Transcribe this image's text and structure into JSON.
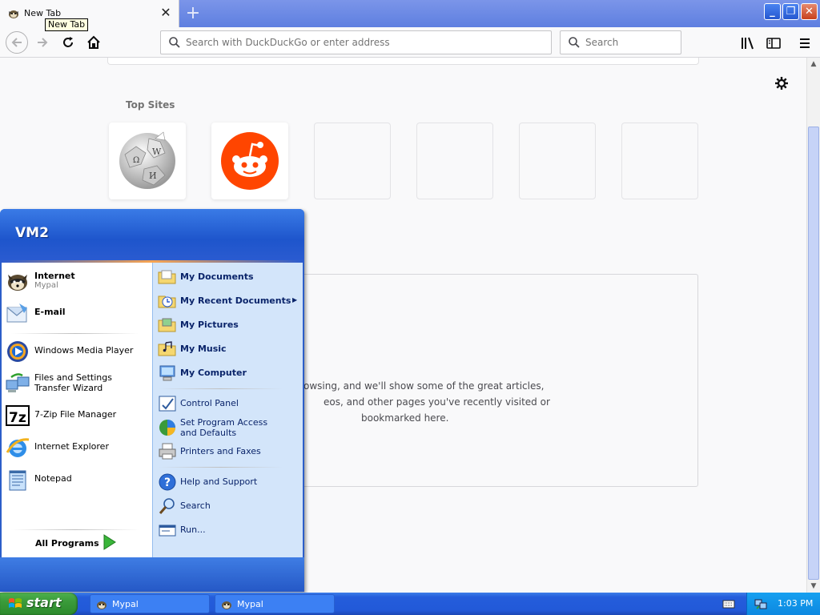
{
  "browser": {
    "tab_title": "New Tab",
    "tooltip": "New Tab",
    "url_placeholder": "Search with DuckDuckGo or enter address",
    "search_placeholder": "Search"
  },
  "newtab": {
    "topsites_title": "Top Sites",
    "topsites": [
      {
        "name": "wikipedia",
        "icon": "wikipedia-globe"
      },
      {
        "name": "reddit",
        "icon": "reddit-alien"
      },
      {
        "name": "empty"
      },
      {
        "name": "empty"
      },
      {
        "name": "empty"
      },
      {
        "name": "empty"
      }
    ],
    "highlights_text": "owsing, and we'll show some of the great articles, eos, and other pages you've recently visited or bookmarked here.",
    "highlights_lines": [
      "owsing, and we'll show some of the great articles,",
      "eos, and other pages you've recently visited or",
      "bookmarked here."
    ]
  },
  "startmenu": {
    "user": "VM2",
    "pinned": [
      {
        "label": "Internet",
        "sub": "Mypal",
        "icon": "mypal-icon"
      },
      {
        "label": "E-mail",
        "icon": "email-icon"
      }
    ],
    "recent": [
      {
        "label": "Windows Media Player",
        "icon": "media-player-icon"
      },
      {
        "label": "Files and Settings Transfer Wizard",
        "icon": "transfer-wizard-icon"
      },
      {
        "label": "7-Zip File Manager",
        "icon": "7zip-icon"
      },
      {
        "label": "Internet Explorer",
        "icon": "ie-icon"
      },
      {
        "label": "Notepad",
        "icon": "notepad-icon"
      }
    ],
    "all_programs": "All Programs",
    "right": [
      {
        "label": "My Documents",
        "icon": "folder-docs-icon"
      },
      {
        "label": "My Recent Documents",
        "icon": "recent-docs-icon"
      },
      {
        "label": "My Pictures",
        "icon": "folder-pictures-icon"
      },
      {
        "label": "My Music",
        "icon": "folder-music-icon"
      },
      {
        "label": "My Computer",
        "icon": "computer-icon"
      },
      {
        "label": "Control Panel",
        "icon": "control-panel-icon"
      },
      {
        "label": "Set Program Access and Defaults",
        "icon": "program-access-icon"
      },
      {
        "label": "Printers and Faxes",
        "icon": "printer-icon"
      },
      {
        "label": "Help and Support",
        "icon": "help-icon"
      },
      {
        "label": "Search",
        "icon": "search-icon"
      },
      {
        "label": "Run...",
        "icon": "run-icon"
      }
    ]
  },
  "taskbar": {
    "start_label": "start",
    "tasks": [
      {
        "label": "Mypal"
      },
      {
        "label": "Mypal"
      }
    ],
    "clock": "1:03 PM"
  }
}
